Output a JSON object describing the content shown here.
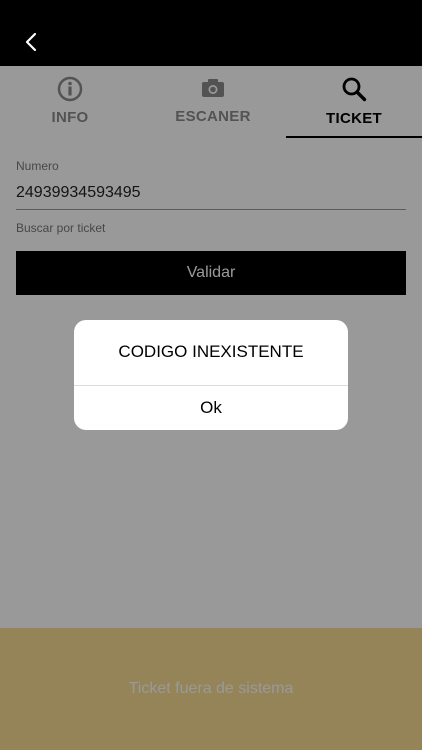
{
  "header": {
    "back_icon": "chevron-left-icon"
  },
  "tabs": [
    {
      "label": "INFO",
      "icon": "info-icon",
      "active": false
    },
    {
      "label": "ESCANER",
      "icon": "camera-icon",
      "active": false
    },
    {
      "label": "TICKET",
      "icon": "search-icon",
      "active": true
    }
  ],
  "form": {
    "field_label": "Numero",
    "field_value": "24939934593495",
    "hint": "Buscar por ticket",
    "button_label": "Validar"
  },
  "bottom_bar": {
    "text": "Ticket fuera de sistema",
    "color": "#f7dc93"
  },
  "dialog": {
    "message": "CODIGO INEXISTENTE",
    "ok_label": "Ok"
  }
}
